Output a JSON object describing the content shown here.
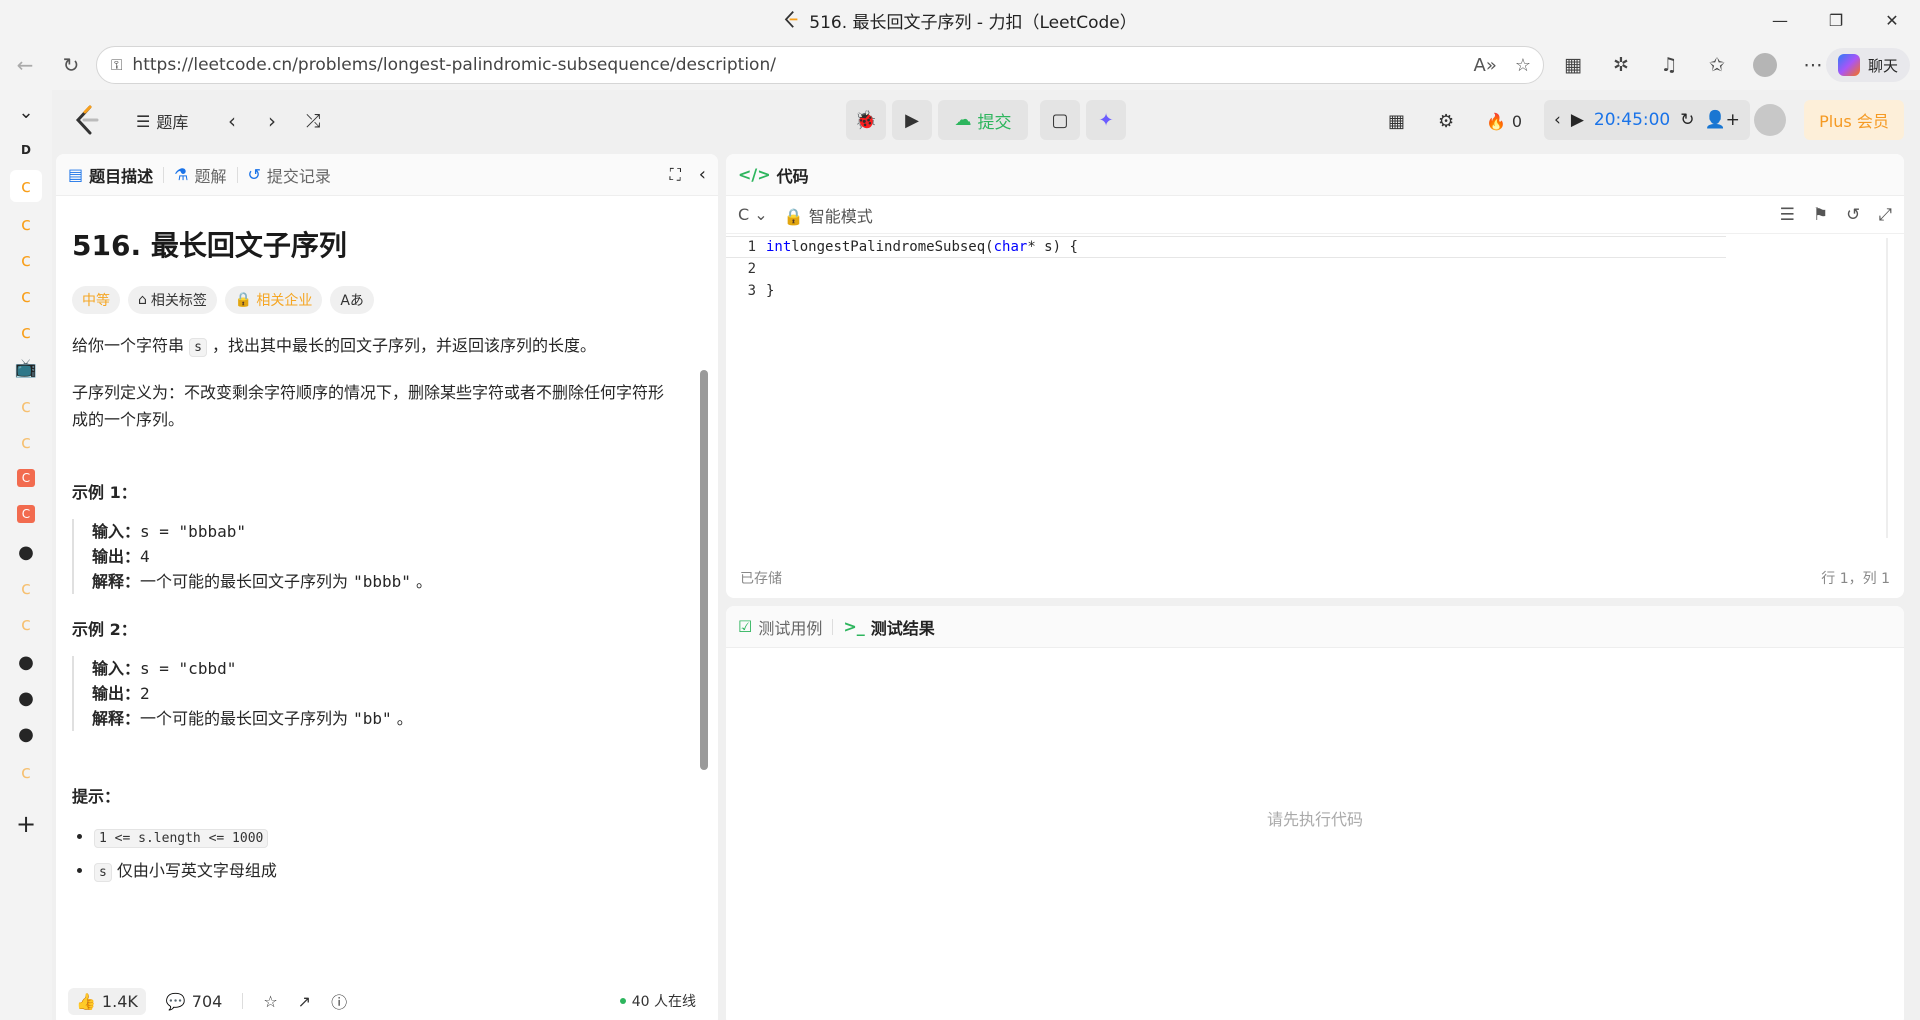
{
  "browser": {
    "window_title": "516. 最长回文子序列 - 力扣（LeetCode）",
    "url": "https://leetcode.cn/problems/longest-palindromic-subsequence/description/",
    "chat_label": "聊天"
  },
  "header": {
    "problem_bank": "题库",
    "submit_label": "提交",
    "streak_count": "0",
    "timer": "20:45:00",
    "plus_label": "Plus 会员"
  },
  "left_panel": {
    "tabs": [
      "题目描述",
      "题解",
      "提交记录"
    ],
    "title": "516. 最长回文子序列",
    "tags": {
      "difficulty": "中等",
      "related_tags": "相关标签",
      "related_companies": "相关企业",
      "font_toggle": "Aあ"
    },
    "para1_before": "给你一个字符串 ",
    "para1_code": "s",
    "para1_after": " ，找出其中最长的回文子序列，并返回该序列的长度。",
    "para2": "子序列定义为：不改变剩余字符顺序的情况下，删除某些字符或者不删除任何字符形成的一个序列。",
    "example1": {
      "title": "示例 1：",
      "input_label": "输入：",
      "input": "s = \"bbbab\"",
      "output_label": "输出：",
      "output": "4",
      "explain_label": "解释：",
      "explain_text": "一个可能的最长回文子序列为 ",
      "explain_code": "\"bbbb\"",
      "explain_end": " 。"
    },
    "example2": {
      "title": "示例 2：",
      "input_label": "输入：",
      "input": "s = \"cbbd\"",
      "output_label": "输出：",
      "output": "2",
      "explain_label": "解释：",
      "explain_text": "一个可能的最长回文子序列为 ",
      "explain_code": "\"bb\"",
      "explain_end": " 。"
    },
    "hints_title": "提示：",
    "hint1_code": "1 <= s.length <= 1000",
    "hint2_code": "s",
    "hint2_text": " 仅由小写英文字母组成",
    "footer": {
      "likes": "1.4K",
      "comments": "704",
      "online": "40 人在线"
    }
  },
  "code_panel": {
    "title": "代码",
    "language": "C",
    "mode": "智能模式",
    "lines": [
      {
        "num": "1",
        "kw": "int",
        "rest1": " longestPalindromeSubseq(",
        "kw2": "char",
        "rest2": "* s) {"
      },
      {
        "num": "2"
      },
      {
        "num": "3",
        "plain": "}"
      }
    ],
    "saved": "已存储",
    "cursor": "行 1，列 1"
  },
  "test_panel": {
    "tab_cases": "测试用例",
    "tab_results": "测试结果",
    "empty": "请先执行代码"
  },
  "colors": {
    "accent_green": "#2db55d",
    "medium": "#f5a623",
    "timer_blue": "#1a73e8"
  }
}
